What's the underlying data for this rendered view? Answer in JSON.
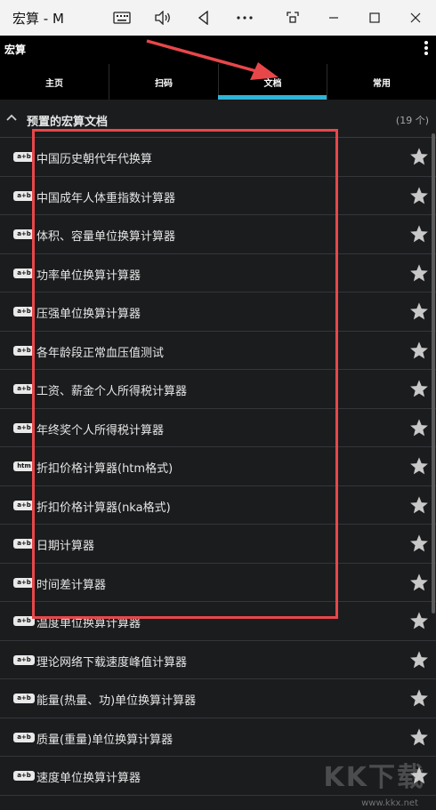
{
  "window": {
    "title": "宏算 - M",
    "icons": [
      "keyboard-icon",
      "volume-icon",
      "back-triangle-icon",
      "more-dots-icon",
      "screenshot-icon",
      "minimize-icon",
      "maximize-icon",
      "close-icon"
    ]
  },
  "app": {
    "title": "宏算"
  },
  "tabs": [
    {
      "label": "主页"
    },
    {
      "label": "扫码"
    },
    {
      "label": "文档",
      "active": true
    },
    {
      "label": "常用"
    }
  ],
  "section": {
    "title": "预置的宏算文档",
    "count": "(19 个)"
  },
  "items": [
    {
      "badge": "a+b",
      "label": "中国历史朝代年代换算"
    },
    {
      "badge": "a+b",
      "label": "中国成年人体重指数计算器"
    },
    {
      "badge": "a+b",
      "label": "体积、容量单位换算计算器"
    },
    {
      "badge": "a+b",
      "label": "功率单位换算计算器"
    },
    {
      "badge": "a+b",
      "label": "压强单位换算计算器"
    },
    {
      "badge": "a+b",
      "label": "各年龄段正常血压值测试"
    },
    {
      "badge": "a+b",
      "label": "工资、薪金个人所得税计算器"
    },
    {
      "badge": "a+b",
      "label": "年终奖个人所得税计算器"
    },
    {
      "badge": "htm",
      "label": "折扣价格计算器(htm格式)"
    },
    {
      "badge": "a+b",
      "label": "折扣价格计算器(nka格式)"
    },
    {
      "badge": "a+b",
      "label": "日期计算器"
    },
    {
      "badge": "a+b",
      "label": "时间差计算器"
    },
    {
      "badge": "a+b",
      "label": "温度单位换算计算器"
    },
    {
      "badge": "a+b",
      "label": "理论网络下载速度峰值计算器"
    },
    {
      "badge": "a+b",
      "label": "能量(热量、功)单位换算计算器"
    },
    {
      "badge": "a+b",
      "label": "质量(重量)单位换算计算器"
    },
    {
      "badge": "a+b",
      "label": "速度单位换算计算器"
    }
  ],
  "colors": {
    "accent": "#2fb4d6",
    "annotation": "#e8474a",
    "background": "#1b1c1e"
  },
  "watermark": {
    "text": "KK下载",
    "url": "www.kkx.net"
  }
}
